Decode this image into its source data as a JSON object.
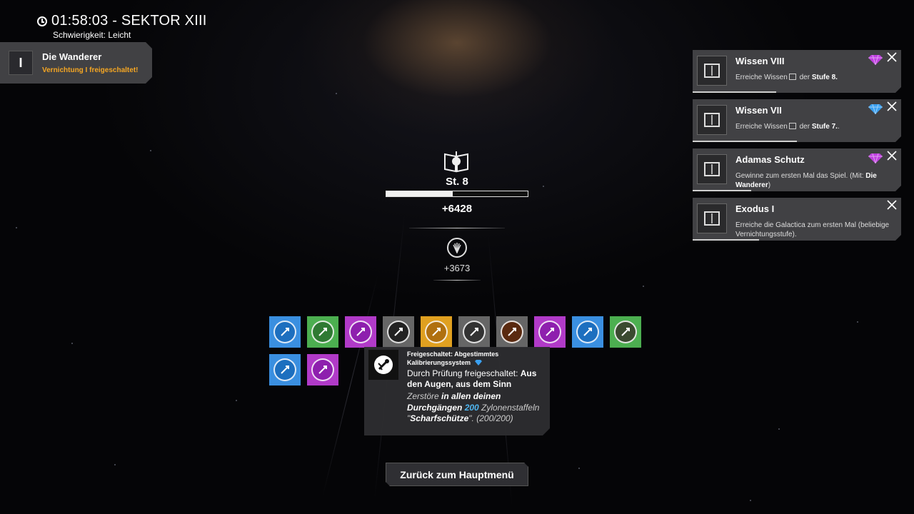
{
  "timer": {
    "time": "01:58:03 - SEKTOR XIII",
    "difficulty": "Schwierigkeit: Leicht"
  },
  "faction": {
    "badge": "I",
    "name": "Die Wanderer",
    "subtitle": "Vernichtung I freigeschaltet!"
  },
  "stats": {
    "level": "St. 8",
    "progress": 0.47,
    "xp_gain": "+6428",
    "points_gain": "+3673"
  },
  "unlocks": [
    {
      "name": "unlock-calibration",
      "color": "#3a8fe0",
      "inner": "#1d6fbf",
      "icon": "wrench-icon",
      "selected": true
    },
    {
      "name": "unlock-green-spark",
      "color": "#4caf50",
      "inner": "#2f7a33",
      "icon": "spark-icon"
    },
    {
      "name": "unlock-ram",
      "color": "#b13ac8",
      "inner": "#8e1fae",
      "icon": "ram-icon"
    },
    {
      "name": "unlock-cylon-helmet",
      "color": "#666",
      "inner": "#222",
      "icon": "helmet-icon"
    },
    {
      "name": "unlock-skull",
      "color": "#e0a020",
      "inner": "#b07010",
      "icon": "skull-icon"
    },
    {
      "name": "unlock-ship-grey",
      "color": "#666",
      "inner": "#333",
      "icon": "ship-icon"
    },
    {
      "name": "unlock-ship-orange",
      "color": "#666",
      "inner": "#5a2a10",
      "icon": "ship-icon"
    },
    {
      "name": "unlock-missiles",
      "color": "#b13ac8",
      "inner": "#8e1fae",
      "icon": "missile-icon"
    },
    {
      "name": "unlock-shield",
      "color": "#3a8fe0",
      "inner": "#1d6fbf",
      "icon": "shield-icon"
    },
    {
      "name": "unlock-hangar",
      "color": "#4caf50",
      "inner": "#3a4a30",
      "icon": "hangar-icon"
    },
    {
      "name": "unlock-gear",
      "color": "#3a8fe0",
      "inner": "#1d6fbf",
      "icon": "gear-icon"
    },
    {
      "name": "unlock-rocket",
      "color": "#b13ac8",
      "inner": "#8e1fae",
      "icon": "rocket-icon"
    }
  ],
  "tooltip": {
    "header": "Freigeschaltet: Abgestimmtes Kalibrierungssystem",
    "body_prefix": "Durch Prüfung freigeschaltet: ",
    "body_bold": "Aus den Augen, aus dem Sinn",
    "desc_1": "Zerstöre ",
    "desc_2": "in allen deinen Durchgängen",
    "desc_3": "200",
    "desc_4": " Zylonenstaffeln \"",
    "desc_5": "Scharfschütze",
    "desc_6": "\". (200/200)"
  },
  "back_button": "Zurück zum Hauptmenü",
  "achievements": [
    {
      "title": "Wissen VIII",
      "desc_a": "Erreiche Wissen",
      "desc_b": " der ",
      "desc_c": "Stufe 8.",
      "desc_d": "",
      "gem": "#c040e0",
      "icon": "book-viii-icon",
      "progress": 0.4
    },
    {
      "title": "Wissen VII",
      "desc_a": "Erreiche Wissen",
      "desc_b": " der ",
      "desc_c": "Stufe 7.",
      "desc_d": ".",
      "gem": "#3aa0f0",
      "icon": "book-vii-icon",
      "progress": 0.5
    },
    {
      "title": "Adamas Schutz",
      "desc_a": "Gewinne zum ersten Mal das Spiel. (Mit: ",
      "desc_c": "Die Wanderer",
      "desc_d": ")",
      "gem": "#c040e0",
      "icon": "medal-icon",
      "progress": 0.28
    },
    {
      "title": "Exodus I",
      "desc_a": "Erreiche die Galactica zum ersten Mal (beliebige Vernichtungsstufe).",
      "gem": "",
      "icon": "crest-icon",
      "progress": 0.32
    }
  ]
}
